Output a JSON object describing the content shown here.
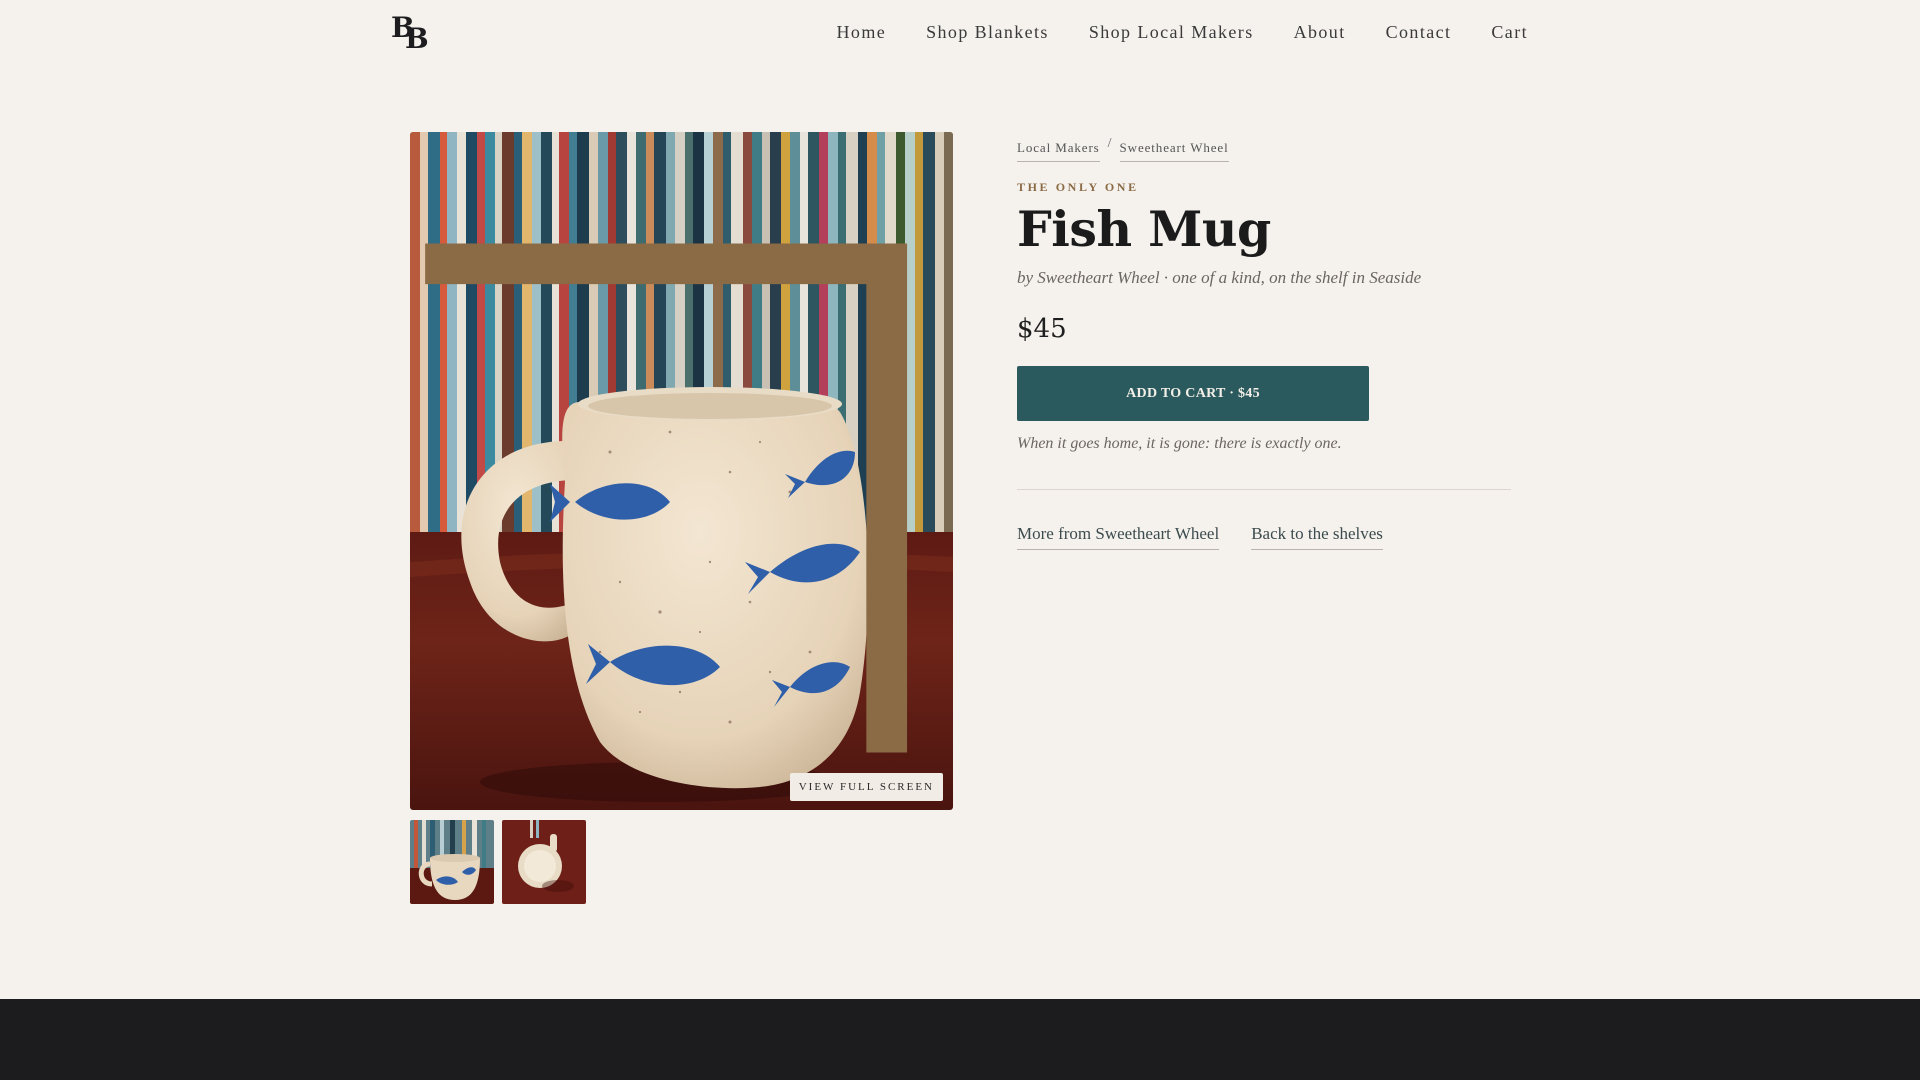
{
  "header": {
    "logo_text": "BB",
    "nav": [
      "Home",
      "Shop Blankets",
      "Shop Local Makers",
      "About",
      "Contact",
      "Cart"
    ]
  },
  "gallery": {
    "fullscreen_label": "VIEW FULL SCREEN",
    "thumbnail_count": 2
  },
  "breadcrumb": {
    "items": [
      "Local Makers",
      "Sweetheart Wheel"
    ],
    "separator": "/"
  },
  "product": {
    "eyebrow": "THE ONLY ONE",
    "title": "Fish Mug",
    "byline": "by Sweetheart Wheel · one of a kind, on the shelf in Seaside",
    "price": "$45",
    "add_to_cart_label": "ADD TO CART · $45",
    "note": "When it goes home, it is gone: there is exactly one."
  },
  "links": {
    "more_from": "More from Sweetheart Wheel",
    "back": "Back to the shelves"
  },
  "colors": {
    "background": "#f5f2ee",
    "accent_button": "#2b5a5e",
    "eyebrow": "#8b6b45",
    "footer": "#1c1c1f"
  },
  "icons": [
    "logo-monogram",
    "corner-mark-icon"
  ]
}
